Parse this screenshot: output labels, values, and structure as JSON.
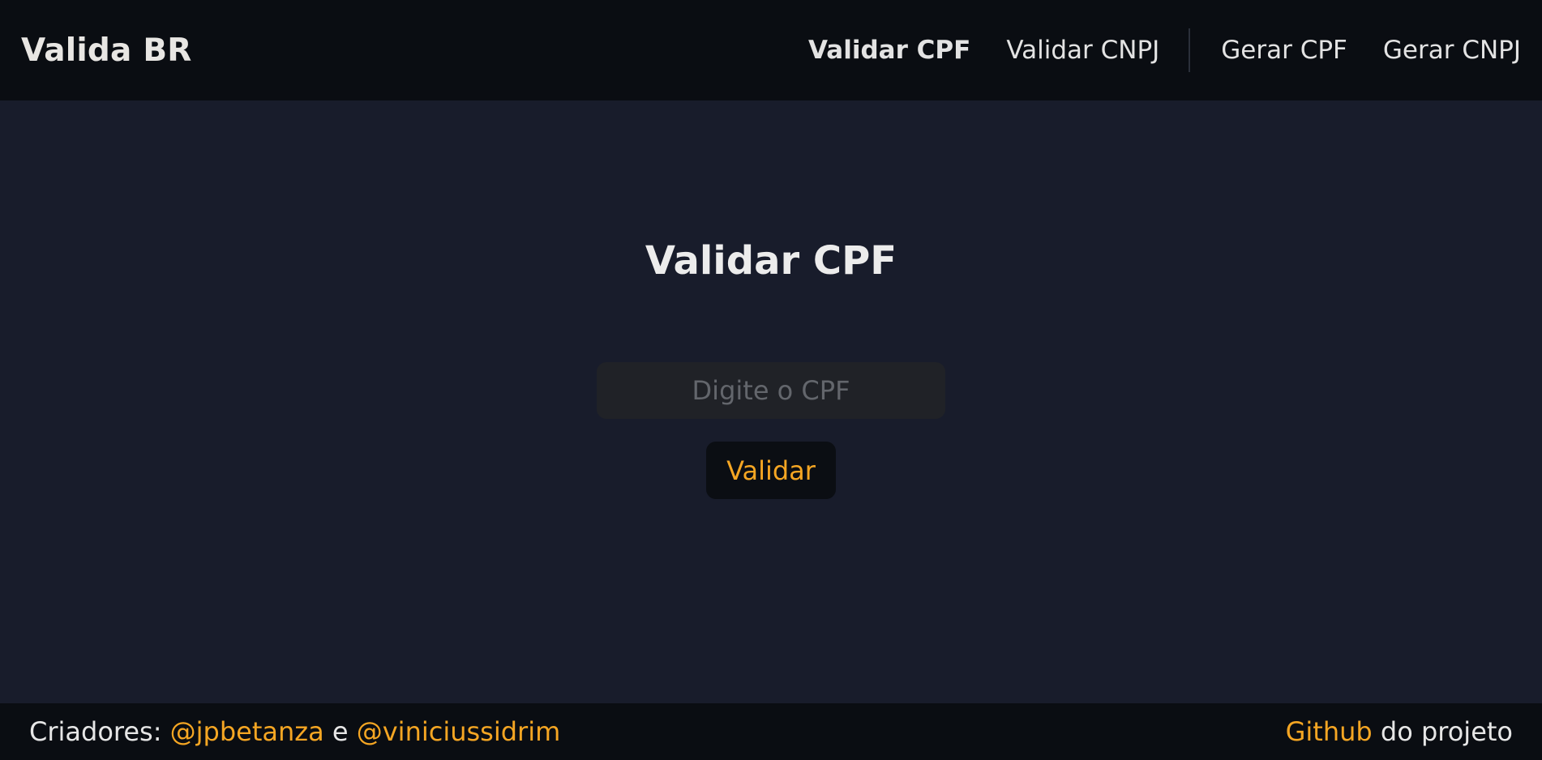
{
  "header": {
    "brand": "Valida BR",
    "nav": [
      {
        "label": "Validar CPF",
        "active": true
      },
      {
        "label": "Validar CNPJ",
        "active": false
      },
      {
        "label": "Gerar CPF",
        "active": false
      },
      {
        "label": "Gerar CNPJ",
        "active": false
      }
    ]
  },
  "main": {
    "title": "Validar CPF",
    "input": {
      "placeholder": "Digite o CPF",
      "value": ""
    },
    "button_label": "Validar"
  },
  "footer": {
    "creators_prefix": "Criadores: ",
    "creator_1": "@jpbetanza",
    "connector": " e ",
    "creator_2": "@viniciussidrim",
    "github_link": "Github",
    "github_suffix": " do projeto"
  },
  "colors": {
    "background": "#181c2b",
    "header_footer": "#0a0d12",
    "accent": "#f5a623",
    "input_bg": "#202227",
    "button_bg": "#0b0e13"
  }
}
